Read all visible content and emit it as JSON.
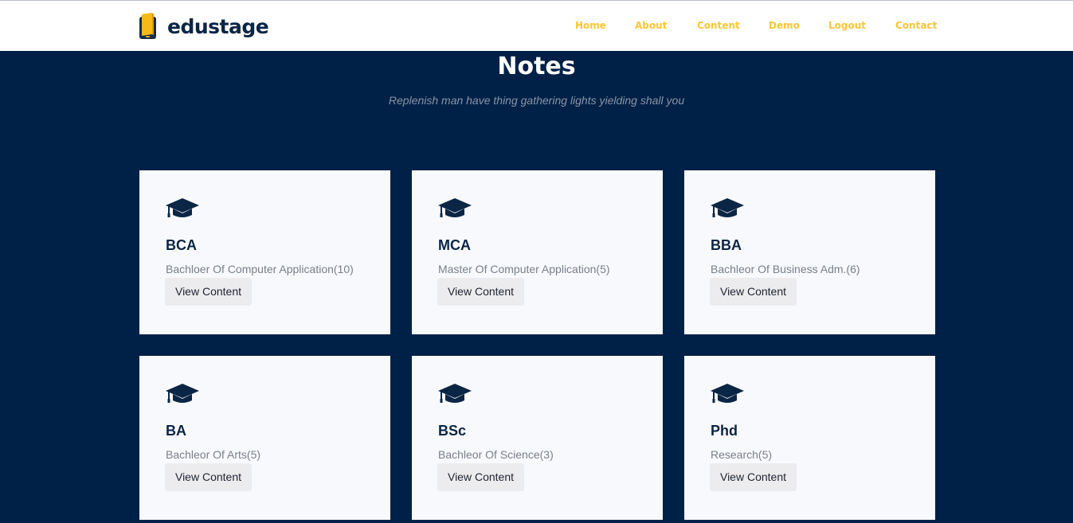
{
  "brand": {
    "name": "edustage"
  },
  "nav": {
    "items": [
      "Home",
      "About",
      "Content",
      "Demo",
      "Logout",
      "Contact"
    ]
  },
  "colors": {
    "navy": "#002147",
    "accent": "#fdc632",
    "card_bg": "#f8f9fd",
    "button_bg": "#ececef"
  },
  "page": {
    "title": "Notes",
    "subtitle": "Replenish man have thing gathering lights yielding shall you"
  },
  "courses": [
    {
      "code": "BCA",
      "description": "Bachloer Of Computer Application(10)",
      "button": "View Content",
      "icon": "graduation-cap-icon"
    },
    {
      "code": "MCA",
      "description": "Master Of Computer Application(5)",
      "button": "View Content",
      "icon": "graduation-cap-icon"
    },
    {
      "code": "BBA",
      "description": "Bachleor Of Business Adm.(6)",
      "button": "View Content",
      "icon": "graduation-cap-icon"
    },
    {
      "code": "BA",
      "description": "Bachleor Of Arts(5)",
      "button": "View Content",
      "icon": "graduation-cap-icon"
    },
    {
      "code": "BSc",
      "description": "Bachleor Of Science(3)",
      "button": "View Content",
      "icon": "graduation-cap-icon"
    },
    {
      "code": "Phd",
      "description": "Research(5)",
      "button": "View Content",
      "icon": "graduation-cap-icon"
    }
  ]
}
